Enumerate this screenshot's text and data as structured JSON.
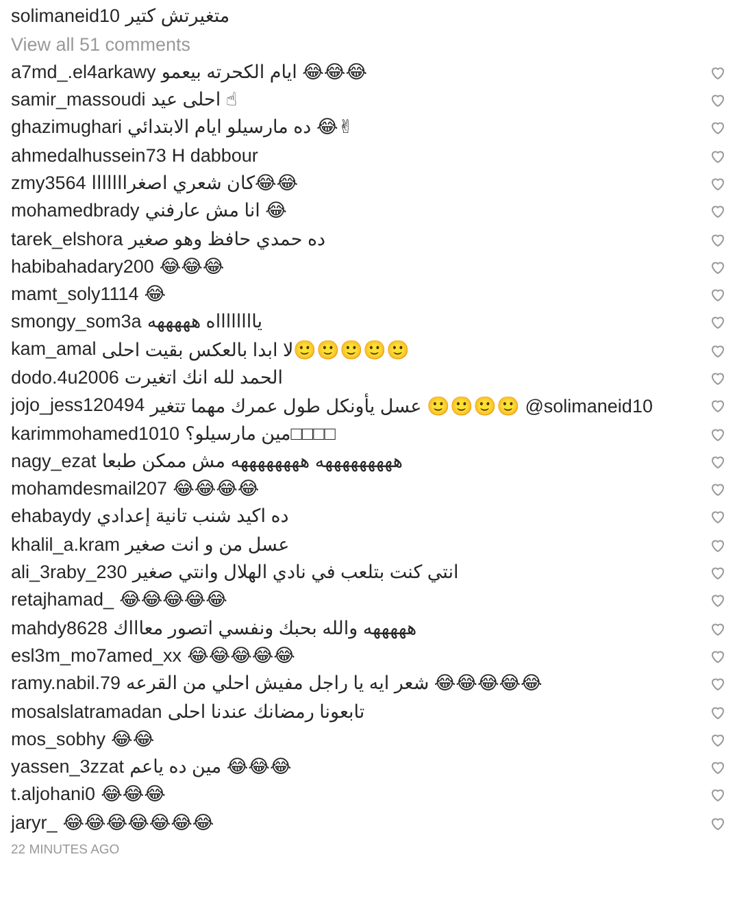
{
  "caption": {
    "username": "solimaneid10",
    "text": "متغيرتش كتير"
  },
  "view_all": "View all 51 comments",
  "comments": [
    {
      "username": "a7md_.el4arkawy",
      "text": "ايام الكحرته بيعمو 😂😂😂",
      "liked": false
    },
    {
      "username": "samir_massoudi",
      "text": "احلى عيد ☝",
      "liked": false
    },
    {
      "username": "ghazimughari",
      "text": "ده مارسيلو ايام الابتدائي 😂✌",
      "liked": false
    },
    {
      "username": "ahmedalhussein73",
      "text": "H dabbour",
      "liked": false
    },
    {
      "username": "zmy3564",
      "text": "كان شعري اصغرااااااا😂😂",
      "liked": false
    },
    {
      "username": "mohamedbrady",
      "text": "انا مش عارفني 😂",
      "liked": false
    },
    {
      "username": "tarek_elshora",
      "text": "ده حمدي حافظ وهو صغير",
      "liked": false
    },
    {
      "username": "habibahadary200",
      "text": "😂😂😂",
      "liked": false
    },
    {
      "username": "mamt_soly1114",
      "text": "😂",
      "liked": false
    },
    {
      "username": "smongy_som3a",
      "text": "يااااااااه هههههه",
      "liked": false
    },
    {
      "username": "kam_amal",
      "text": "لا ابدا بالعكس بقيت احلى🙂🙂🙂🙂🙂",
      "liked": false
    },
    {
      "username": "dodo.4u2006",
      "text": "الحمد لله انك اتغيرت",
      "liked": false
    },
    {
      "username": "jojo_jess120494",
      "text": "عسل يأونكل طول عمرك مهما تتغير 🙂🙂🙂🙂 @solimaneid10",
      "liked": false
    },
    {
      "username": "karimmohamed1010",
      "text": "مين مارسيلو؟□□□□",
      "liked": false
    },
    {
      "username": "nagy_ezat",
      "text": "هههههههههه ههههههههه مش ممكن طبعا",
      "liked": false
    },
    {
      "username": "mohamdesmail207",
      "text": "😂😂😂😂",
      "liked": false
    },
    {
      "username": "ehabaydy",
      "text": "ده اكيد شنب تانية إعدادي",
      "liked": false
    },
    {
      "username": "khalil_a.kram",
      "text": "عسل من و انت صغير",
      "liked": false
    },
    {
      "username": "ali_3raby_230",
      "text": "انتي كنت بتلعب في نادي الهلال وانتي صغير",
      "liked": false
    },
    {
      "username": "retajhamad_",
      "text": "😂😂😂😂😂",
      "liked": false
    },
    {
      "username": "mahdy8628",
      "text": "هههههه والله بحبك ونفسي اتصور معاااك",
      "liked": false
    },
    {
      "username": "esl3m_mo7amed_xx",
      "text": "😂😂😂😂😂",
      "liked": false
    },
    {
      "username": "ramy.nabil.79",
      "text": "شعر ايه يا راجل مفيش احلي من القرعه 😂😂😂😂😂",
      "liked": false
    },
    {
      "username": "mosalslatramadan",
      "text": "تابعونا رمضانك عندنا احلى",
      "liked": false
    },
    {
      "username": "mos_sobhy",
      "text": "😂😂",
      "liked": false
    },
    {
      "username": "yassen_3zzat",
      "text": "مين ده ياعم 😂😂😂",
      "liked": false
    },
    {
      "username": "t.aljohani0",
      "text": "😂😂😂",
      "liked": false
    },
    {
      "username": "jaryr_",
      "text": "😂😂😂😂😂😂😂",
      "liked": false
    }
  ],
  "timestamp": "22 MINUTES AGO"
}
